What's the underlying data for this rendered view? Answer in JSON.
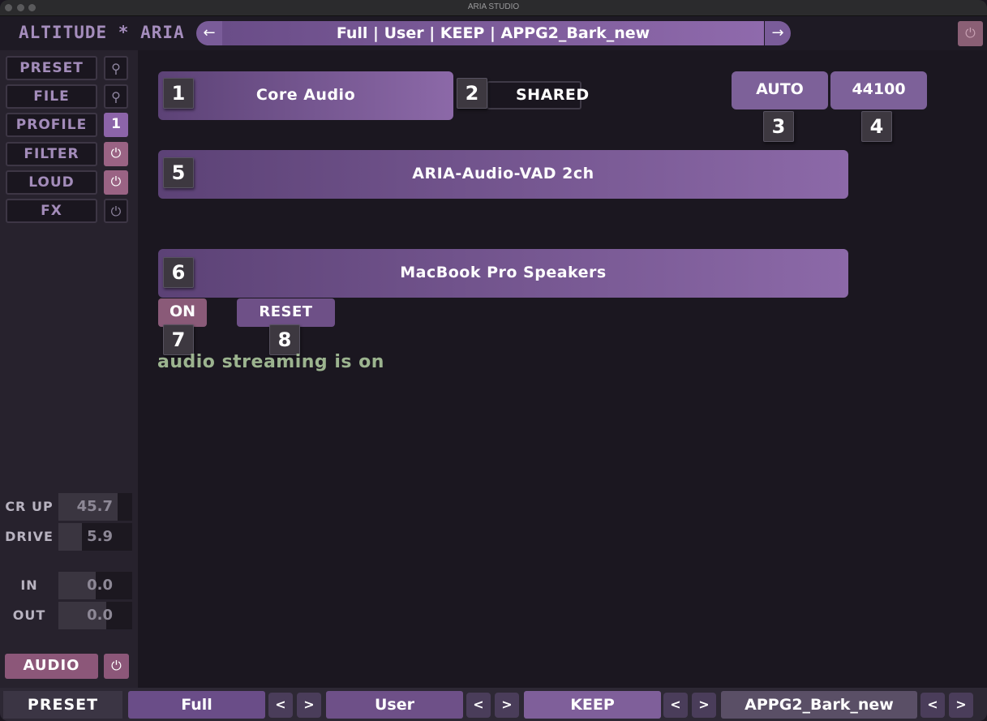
{
  "window": {
    "title": "ARIA STUDIO"
  },
  "header": {
    "app_title": "ALTITUDE * ARIA",
    "path": "Full | User | KEEP | APPG2_Bark_new",
    "prev_icon": "arrow-left-icon",
    "next_icon": "arrow-right-icon",
    "power_icon": "power-icon"
  },
  "sidebar": {
    "buttons": [
      {
        "label": "PRESET",
        "icon": "pin-icon",
        "icon_text": "⚲"
      },
      {
        "label": "FILE",
        "icon": "pin-icon",
        "icon_text": "⚲"
      },
      {
        "label": "PROFILE",
        "icon": "number-badge",
        "icon_text": "1"
      },
      {
        "label": "FILTER",
        "icon": "power-icon",
        "icon_text": "⏻"
      },
      {
        "label": "LOUD",
        "icon": "power-icon",
        "icon_text": "⏻"
      },
      {
        "label": "FX",
        "icon": "power-icon",
        "icon_text": "⏻"
      }
    ],
    "meters": [
      {
        "label": "CR UP",
        "value": "45.7",
        "level": 0.8
      },
      {
        "label": "DRIVE",
        "value": "5.9",
        "level": 0.32
      },
      {
        "label": "IN",
        "value": "0.0",
        "level": 0.5
      },
      {
        "label": "OUT",
        "value": "0.0",
        "level": 0.65
      }
    ],
    "audio": {
      "label": "AUDIO",
      "power_icon": "⏻"
    }
  },
  "main": {
    "driver": {
      "label": "Core Audio",
      "badge": "1"
    },
    "mode": {
      "label": "SHARED",
      "badge": "2"
    },
    "auto": {
      "label": "AUTO",
      "badge": "3"
    },
    "samplerate": {
      "label": "44100",
      "badge": "4"
    },
    "input_device": {
      "label": "ARIA-Audio-VAD 2ch",
      "badge": "5"
    },
    "output_device": {
      "label": "MacBook Pro Speakers",
      "badge": "6"
    },
    "on_button": {
      "label": "ON",
      "badge": "7"
    },
    "reset_button": {
      "label": "RESET",
      "badge": "8"
    },
    "status": "audio streaming is on"
  },
  "footer": {
    "preset_label": "PRESET",
    "fields": [
      "Full",
      "User",
      "KEEP",
      "APPG2_Bark_new"
    ],
    "prev": "<",
    "next": ">"
  },
  "colors": {
    "accent": "#8c69a8",
    "on_button": "#8a5a78",
    "status_text": "#9cb48f",
    "background": "#1b1720"
  }
}
